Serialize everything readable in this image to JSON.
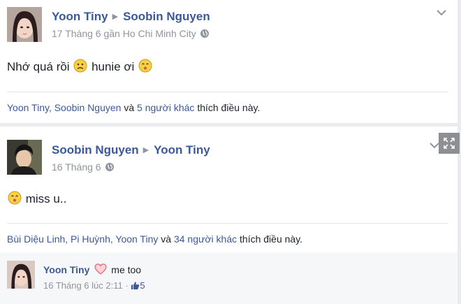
{
  "post1": {
    "author": "Yoon Tiny",
    "target": "Soobin Nguyen",
    "timestamp": "17 Tháng 6 gần Ho Chi Minh City",
    "text_before": "Nhớ quá rồi",
    "text_middle": "hunie ơi",
    "likers_named": "Yoon Tiny, Soobin Nguyen",
    "likers_and": "và",
    "likers_others": "5 người khác",
    "likers_suffix": "thích điều này."
  },
  "post2": {
    "author": "Soobin Nguyen",
    "target": "Yoon Tiny",
    "timestamp": "16 Tháng 6",
    "text": "miss u..",
    "likers_named": "Bùi Diệu Linh, Pi Huỳnh, Yoon Tiny",
    "likers_and": "và",
    "likers_others": "34 người khác",
    "likers_suffix": "thích điều này."
  },
  "comment": {
    "author": "Yoon Tiny",
    "text": "me too",
    "timestamp": "16 Tháng 6 lúc 2:11",
    "separator": "·",
    "like_count": "5"
  },
  "icons": {
    "privacy": "globe-icon",
    "menu": "chevron-down-icon",
    "expand": "expand-icon",
    "emoji_sad": "frowning-face-emoji",
    "emoji_kiss": "kissing-face-emoji",
    "emoji_heart": "heart-emoji",
    "like": "thumbs-up-icon"
  },
  "colors": {
    "link": "#3b5998",
    "meta": "#90949c",
    "background": "#e9ebee",
    "comment_bg": "#f6f7f9"
  }
}
